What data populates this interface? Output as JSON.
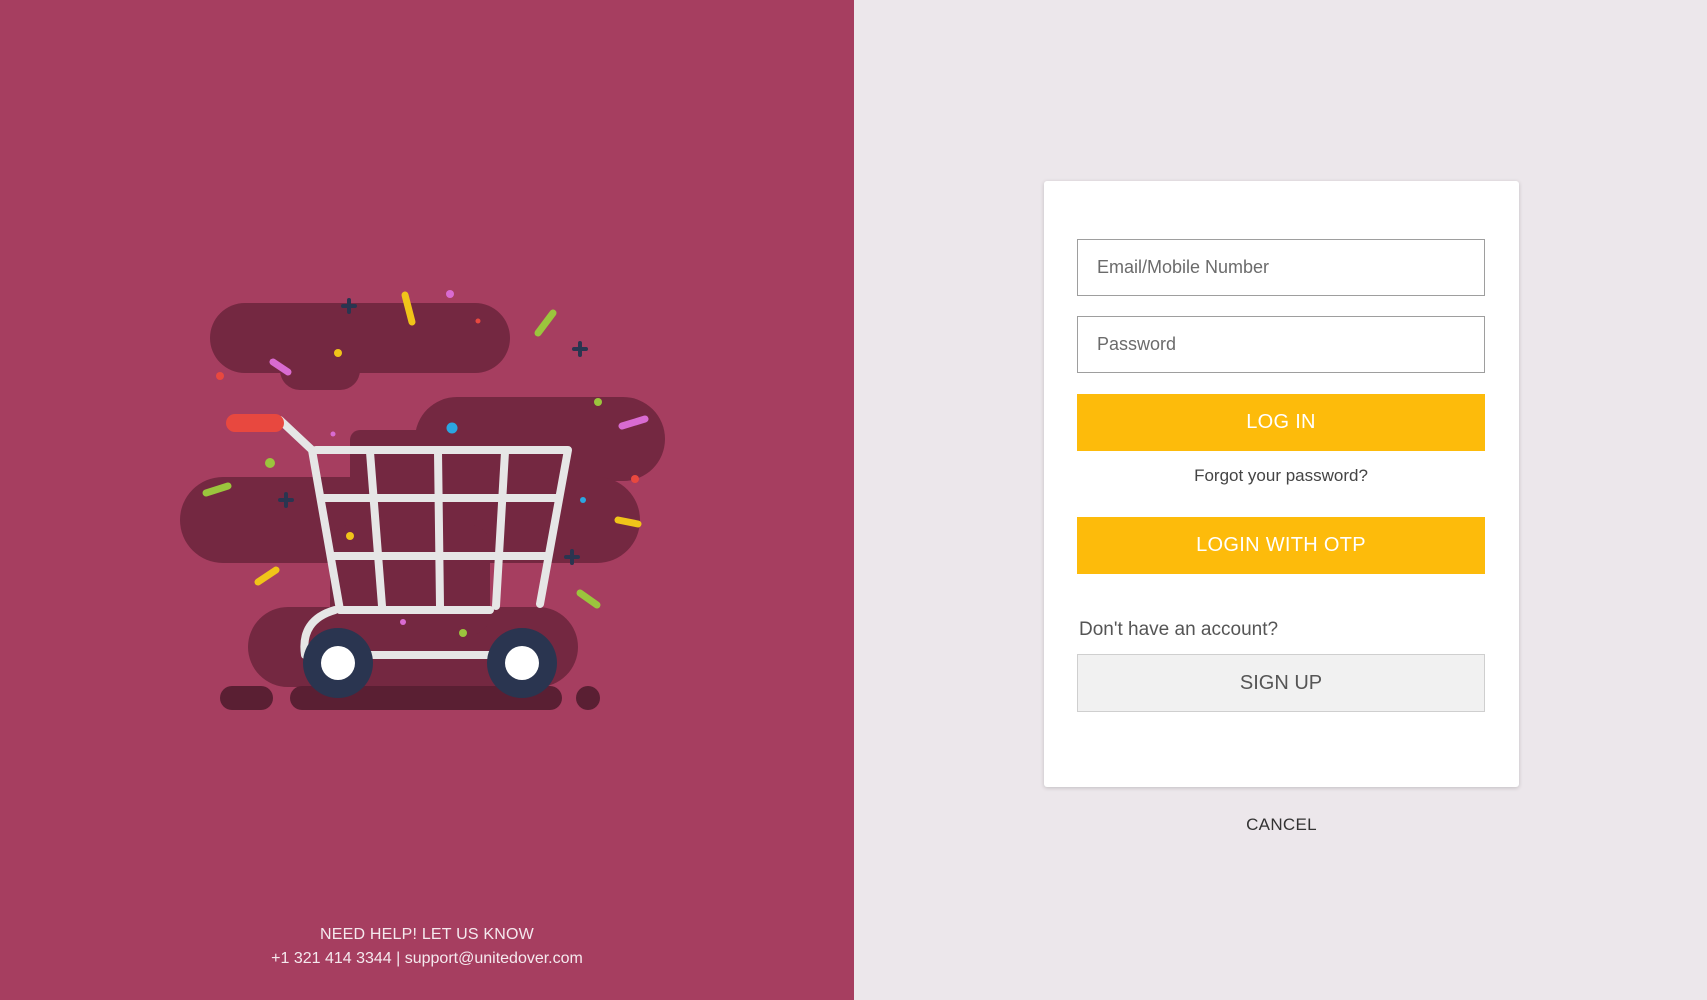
{
  "left": {
    "help_title": "NEED HELP! LET US KNOW",
    "help_contact": "+1 321 414 3344 | support@unitedover.com",
    "illustration_icon": "shopping-cart-illustration",
    "background_color": "#a63e60"
  },
  "login": {
    "email_placeholder": "Email/Mobile Number",
    "password_placeholder": "Password",
    "login_label": "LOG IN",
    "forgot_label": "Forgot your password?",
    "otp_label": "LOGIN WITH OTP",
    "no_account_label": "Don't have an account?",
    "signup_label": "SIGN UP",
    "cancel_label": "CANCEL",
    "accent_color": "#fdbb0b"
  }
}
